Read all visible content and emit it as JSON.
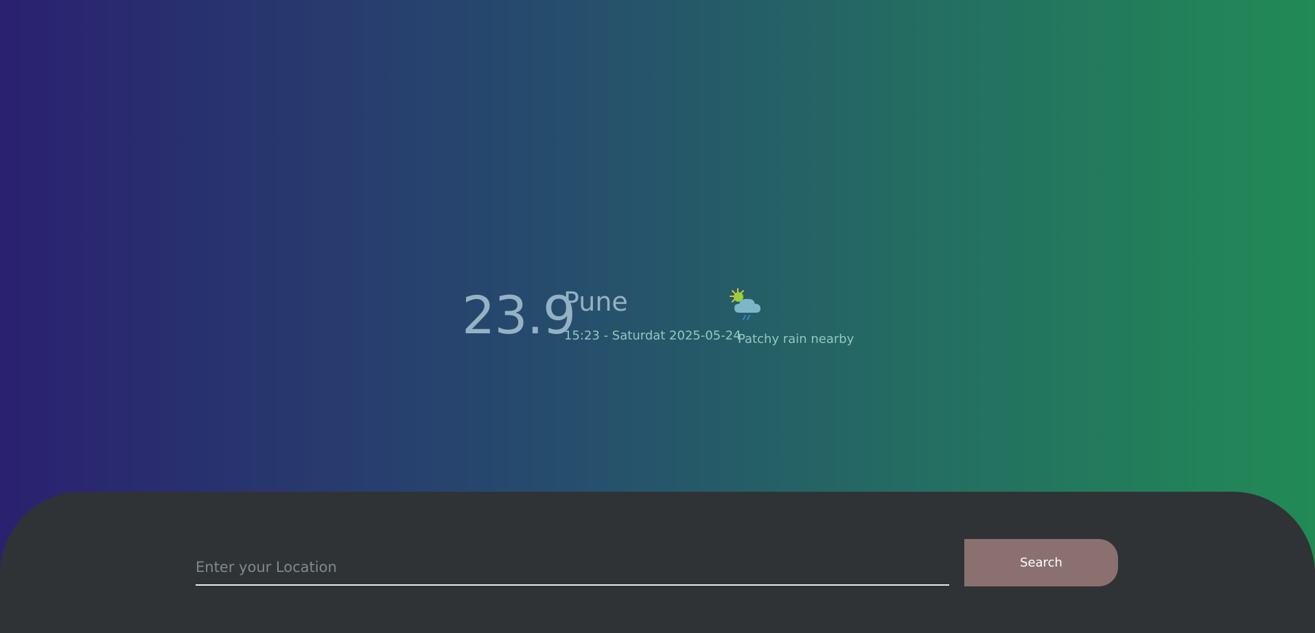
{
  "weather": {
    "temperature": "23.9",
    "city": "Pune",
    "datetime": "15:23 - Saturdat 2025-05-24",
    "condition": "Patchy rain nearby",
    "icon": "partly-cloudy-rain-icon"
  },
  "search": {
    "placeholder": "Enter your Location",
    "value": "",
    "button_label": "Search"
  },
  "colors": {
    "gradient_start": "#2a2170",
    "gradient_end": "#218a55",
    "panel": "#303335",
    "button": "#8a7170"
  }
}
